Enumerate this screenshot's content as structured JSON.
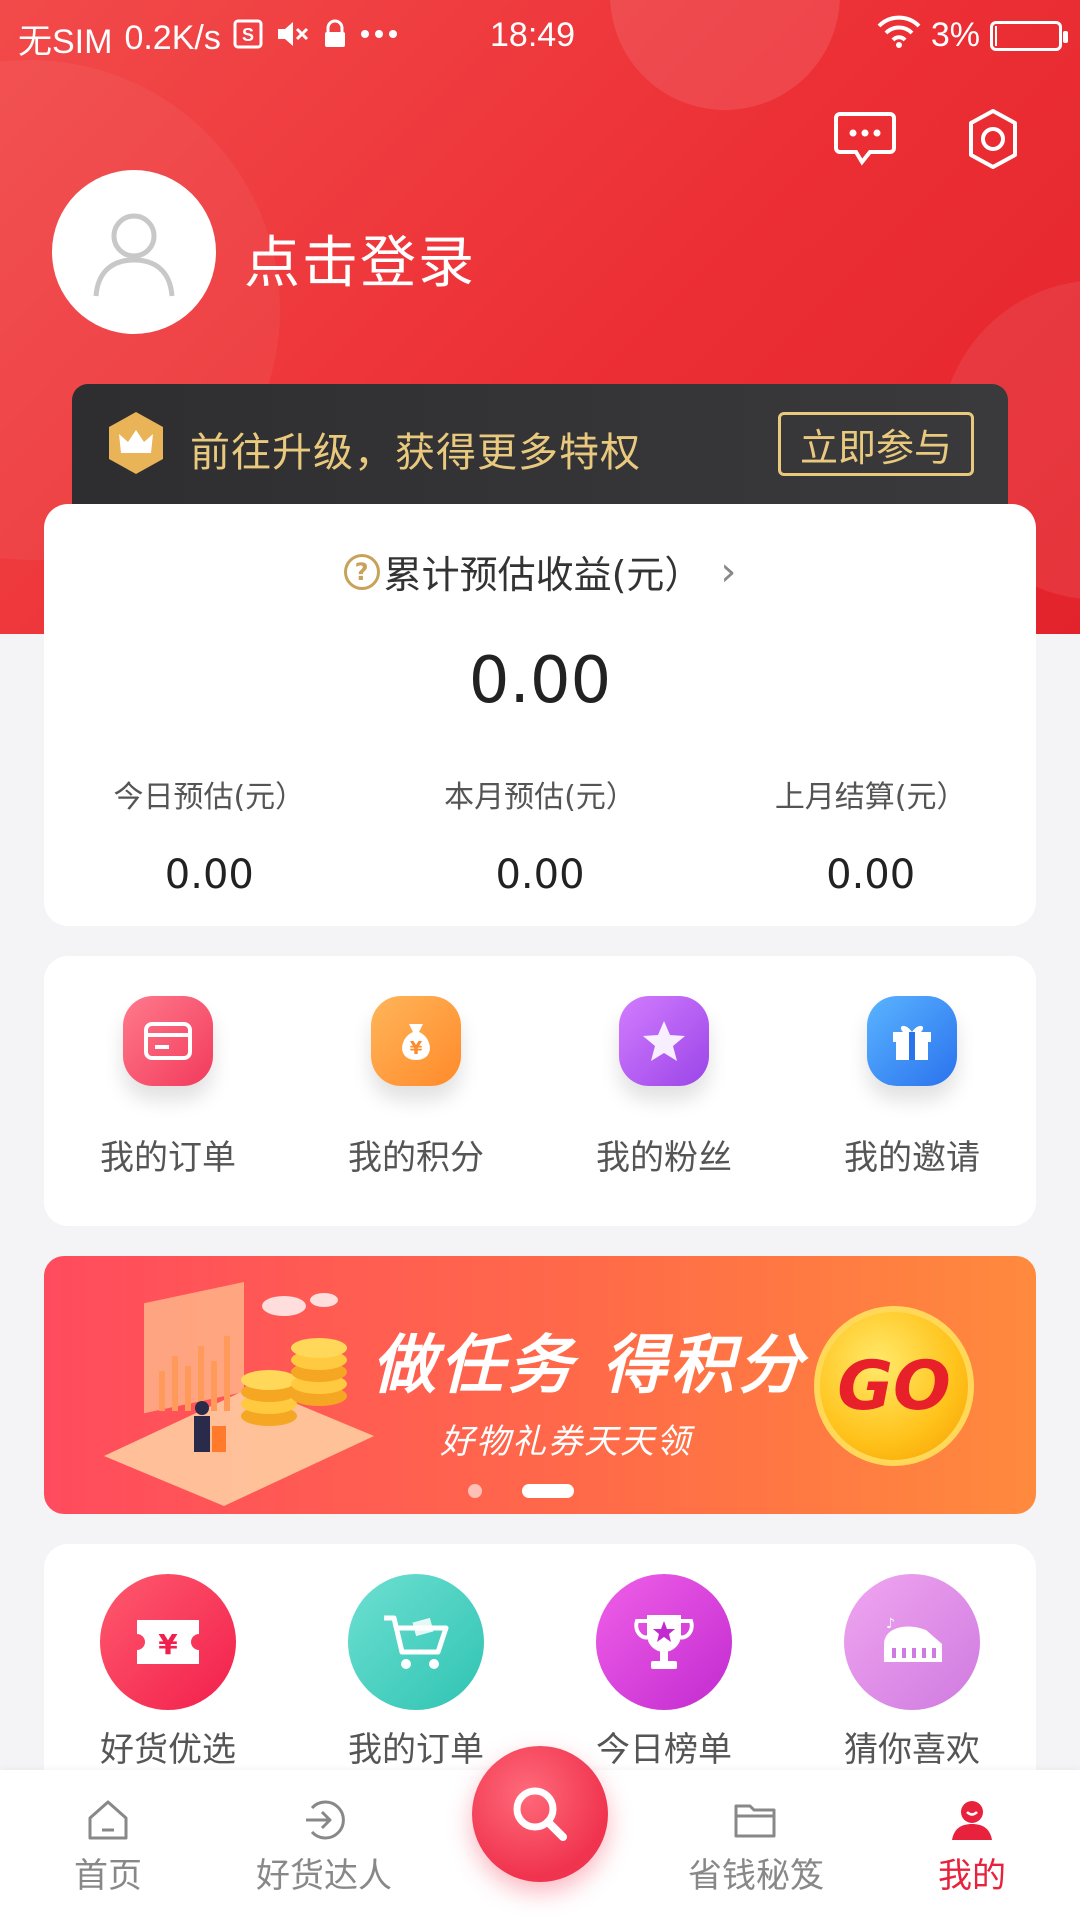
{
  "status_bar": {
    "carrier": "无SIM",
    "speed": "0.2K/s",
    "time": "18:49",
    "battery": "3%",
    "battery_level": 0.03
  },
  "header": {
    "login_text": "点击登录",
    "message_icon": "chat-message-icon",
    "settings_icon": "gear-icon"
  },
  "vip": {
    "text": "前往升级，获得更多特权",
    "button": "立即参与",
    "accent": "#e9c97d"
  },
  "earnings": {
    "title": "累计预估收益(元）",
    "total": "0.00",
    "stats": [
      {
        "label": "今日预估(元）",
        "value": "0.00"
      },
      {
        "label": "本月预估(元）",
        "value": "0.00"
      },
      {
        "label": "上月结算(元）",
        "value": "0.00"
      }
    ]
  },
  "menu": [
    {
      "label": "我的订单",
      "icon": "order-card-icon",
      "color": "#f24d6b"
    },
    {
      "label": "我的积分",
      "icon": "money-bag-icon",
      "color": "#ff9a3c"
    },
    {
      "label": "我的粉丝",
      "icon": "star-icon",
      "color": "#b35cf0"
    },
    {
      "label": "我的邀请",
      "icon": "gift-icon",
      "color": "#3a8ef6"
    }
  ],
  "banner": {
    "title": "做任务 得积分",
    "subtitle": "好物礼券天天领",
    "go": "GO",
    "active_slide": 2,
    "slide_count": 2
  },
  "services": [
    {
      "label": "好货优选",
      "icon": "coupon-yen-icon",
      "color": "#f7335b"
    },
    {
      "label": "我的订单",
      "icon": "shopping-cart-icon",
      "color": "#3fd1c0"
    },
    {
      "label": "今日榜单",
      "icon": "trophy-icon",
      "color": "#d93ad6"
    },
    {
      "label": "猜你喜欢",
      "icon": "piano-icon",
      "color": "#d889e6"
    }
  ],
  "tabbar": {
    "tabs": [
      {
        "label": "首页",
        "icon": "home-icon"
      },
      {
        "label": "好货达人",
        "icon": "arrow-circle-icon"
      },
      {
        "label": "省钱秘笈",
        "icon": "folder-icon"
      },
      {
        "label": "我的",
        "icon": "user-icon"
      }
    ],
    "active": "我的",
    "active_color": "#e8223c"
  }
}
